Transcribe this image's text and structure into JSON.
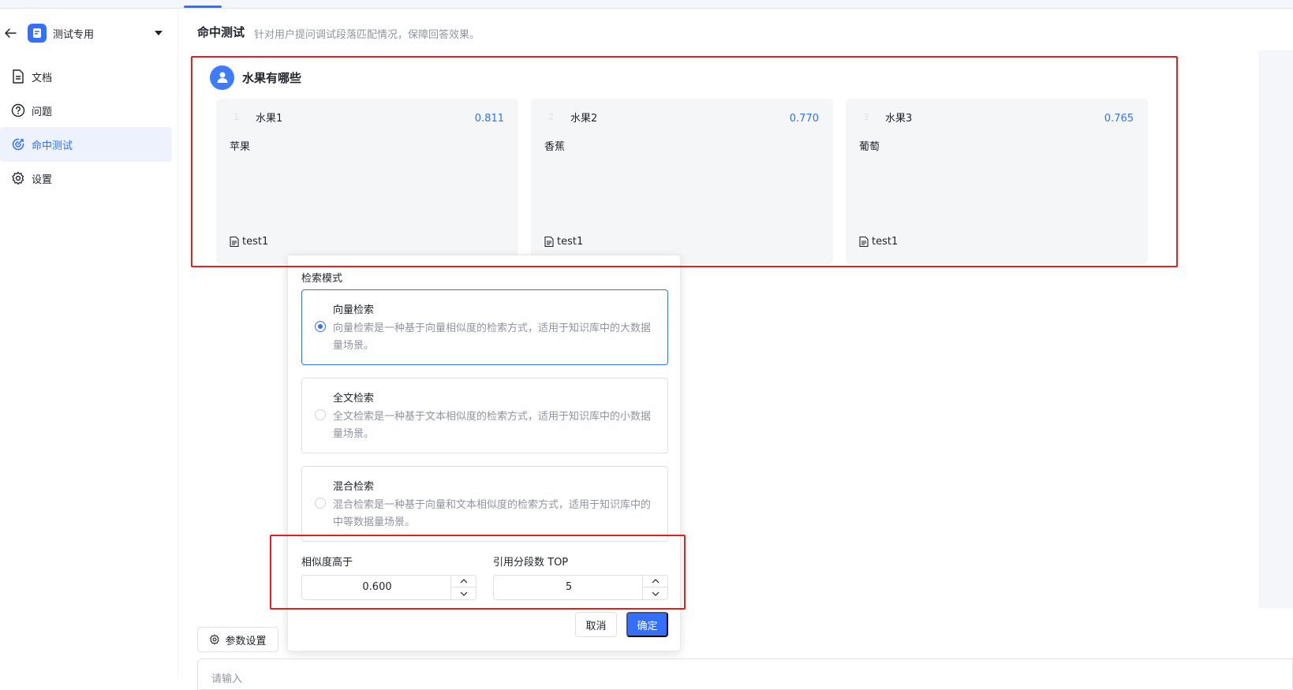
{
  "colors": {
    "accent": "#3370ff",
    "highlight": "#e61e1e"
  },
  "sidebar": {
    "kb_name": "测试专用",
    "items": [
      {
        "label": "文档",
        "icon": "document-icon",
        "active": false
      },
      {
        "label": "问题",
        "icon": "question-circle-icon",
        "active": false
      },
      {
        "label": "命中测试",
        "icon": "target-icon",
        "active": true
      },
      {
        "label": "设置",
        "icon": "gear-icon",
        "active": false
      }
    ]
  },
  "header": {
    "title": "命中测试",
    "subtitle": "针对用户提问调试段落匹配情况，保障回答效果。"
  },
  "question": {
    "text": "水果有哪些"
  },
  "results": [
    {
      "index": "1",
      "name": "水果1",
      "score": "0.811",
      "content": "苹果",
      "source": "test1"
    },
    {
      "index": "2",
      "name": "水果2",
      "score": "0.770",
      "content": "香蕉",
      "source": "test1"
    },
    {
      "index": "3",
      "name": "水果3",
      "score": "0.765",
      "content": "葡萄",
      "source": "test1"
    }
  ],
  "settings": {
    "mode_label": "检索模式",
    "modes": [
      {
        "title": "向量检索",
        "desc": "向量检索是一种基于向量相似度的检索方式，适用于知识库中的大数据量场景。",
        "selected": true
      },
      {
        "title": "全文检索",
        "desc": "全文检索是一种基于文本相似度的检索方式，适用于知识库中的小数据量场景。",
        "selected": false
      },
      {
        "title": "混合检索",
        "desc": "混合检索是一种基于向量和文本相似度的检索方式，适用于知识库中的中等数据量场景。",
        "selected": false
      }
    ],
    "similarity_label": "相似度高于",
    "similarity_value": "0.600",
    "top_label": "引用分段数 TOP",
    "top_value": "5",
    "cancel_label": "取消",
    "confirm_label": "确定"
  },
  "param_button_label": "参数设置",
  "input_placeholder": "请输入"
}
